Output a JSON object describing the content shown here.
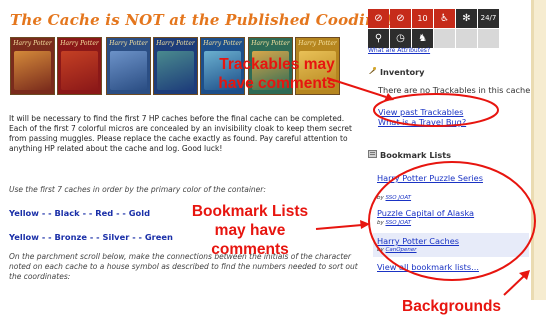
{
  "page": {
    "title": "The Cache is NOT at the Published Coodinates",
    "books": [
      {
        "label": "Harry Potter",
        "color": "#7a2b1c",
        "art": "#d48a3a"
      },
      {
        "label": "Harry Potter",
        "color": "#8b1818",
        "art": "#c44024"
      },
      {
        "label": "Harry Potter",
        "color": "#2b4e84",
        "art": "#6c92c8"
      },
      {
        "label": "Harry Potter",
        "color": "#1d3c7a",
        "art": "#4a8a8e"
      },
      {
        "label": "Harry Potter",
        "color": "#1d4f8a",
        "art": "#6bb0cf"
      },
      {
        "label": "Harry Potter",
        "color": "#2e6b55",
        "art": "#d9a74a"
      },
      {
        "label": "Harry Potter",
        "color": "#b6861f",
        "art": "#e9c157"
      }
    ],
    "intro": "It will be necessary to find the first 7 HP caches before the final cache can be completed. Each of the first 7 colorful micros are concealed by an invisibility cloak to keep them secret from passing muggles. Please replace the cache exactly as found. Pay careful attention to anything HP related about the cache and log. Good luck!",
    "order_note": "Use the first 7 caches in order by the primary color of the container:",
    "colors_line_1": "Yellow - - Black - - Red - - Gold",
    "colors_line_2": "Yellow - - Bronze - - Silver - - Green",
    "parchment_note": "On the parchment scroll below, make the connections between the initials of the character noted on each cache to a house symbol as described to find the numbers needed to sort out the coordinates:"
  },
  "sidebar": {
    "attributes_link": "What are Attributes?",
    "attributes": [
      {
        "icon": "no-dogs-icon",
        "glyph": "⊘",
        "tone": "red"
      },
      {
        "icon": "no-kids-icon",
        "glyph": "⊘",
        "tone": "red"
      },
      {
        "icon": "distance-icon",
        "glyph": "10",
        "tone": "red"
      },
      {
        "icon": "wheelchair-icon",
        "glyph": "♿",
        "tone": "red"
      },
      {
        "icon": "winter-icon",
        "glyph": "✻",
        "tone": "dark"
      },
      {
        "icon": "available-24-7-icon",
        "glyph": "24/7",
        "tone": "dark"
      },
      {
        "icon": "bicycle-icon",
        "glyph": "⚲",
        "tone": "dark"
      },
      {
        "icon": "clock-icon",
        "glyph": "◷",
        "tone": "dark"
      },
      {
        "icon": "dog-icon",
        "glyph": "♞",
        "tone": "dark"
      },
      {
        "icon": "blank-attribute-1",
        "glyph": "",
        "tone": "gray"
      },
      {
        "icon": "blank-attribute-2",
        "glyph": "",
        "tone": "gray"
      },
      {
        "icon": "blank-attribute-3",
        "glyph": "",
        "tone": "gray"
      }
    ],
    "inventory_title": "Inventory",
    "inventory_text": "There are no Trackables in this cache.",
    "view_trackables": "View past Trackables",
    "travel_bug": "What is a Travel Bug?",
    "bookmarks_title": "Bookmark Lists",
    "bookmarks": [
      {
        "name": "Harry Potter Puzzle Series",
        "by_prefix": "by",
        "owner": "SSO JOAT"
      },
      {
        "name": "Puzzle Capital of Alaska",
        "by_prefix": "by",
        "owner": "SSO JOAT"
      },
      {
        "name": "Harry Potter Caches",
        "by_prefix": "by",
        "owner": "CanOpener"
      }
    ],
    "view_all_bookmarks": "View all bookmark lists..."
  },
  "annotations": {
    "trackables": "Trackables may have comments",
    "bookmarks": "Bookmark Lists may have comments",
    "backgrounds": "Backgrounds"
  },
  "colors": {
    "title": "#e4761d",
    "link": "#1a33c4",
    "annotation": "#e7150f",
    "bookmark_highlight": "#e7ebf9",
    "background_stripe": "#f6ecd0"
  }
}
